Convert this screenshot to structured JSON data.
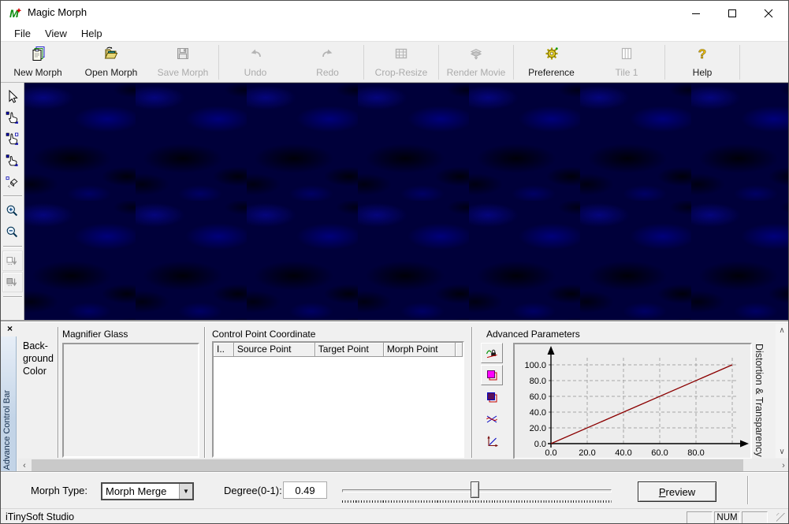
{
  "window": {
    "title": "Magic Morph"
  },
  "menu": {
    "items": [
      "File",
      "View",
      "Help"
    ]
  },
  "toolbar": {
    "buttons": [
      {
        "label": "New Morph",
        "icon": "new-morph-icon",
        "enabled": true
      },
      {
        "label": "Open Morph",
        "icon": "open-morph-icon",
        "enabled": true
      },
      {
        "label": "Save Morph",
        "icon": "save-morph-icon",
        "enabled": false
      },
      {
        "label": "Undo",
        "icon": "undo-icon",
        "enabled": false
      },
      {
        "label": "Redo",
        "icon": "redo-icon",
        "enabled": false
      },
      {
        "label": "Crop-Resize",
        "icon": "crop-resize-icon",
        "enabled": false
      },
      {
        "label": "Render Movie",
        "icon": "render-movie-icon",
        "enabled": false
      },
      {
        "label": "Preference",
        "icon": "preference-icon",
        "enabled": true
      },
      {
        "label": "Tile 1",
        "icon": "tile-icon",
        "enabled": false
      },
      {
        "label": "Help",
        "icon": "help-icon",
        "enabled": true
      }
    ]
  },
  "tool_palette": {
    "tools": [
      {
        "name": "select-tool",
        "enabled": true
      },
      {
        "name": "add-point-tool",
        "enabled": true
      },
      {
        "name": "add-point-pair-tool",
        "enabled": true
      },
      {
        "name": "move-point-tool",
        "enabled": true
      },
      {
        "name": "delete-point-tool",
        "enabled": true
      },
      {
        "name": "zoom-in-tool",
        "enabled": true
      },
      {
        "name": "zoom-out-tool",
        "enabled": true
      },
      {
        "name": "apply-image-1-tool",
        "enabled": false
      },
      {
        "name": "apply-image-2-tool",
        "enabled": false
      }
    ]
  },
  "panel": {
    "sidebar_label": "Advance Control Bar",
    "background_color_lines": [
      "Back-",
      "ground",
      "Color"
    ],
    "magnifier_title": "Magnifier Glass",
    "control_points": {
      "title": "Control Point Coordinate",
      "columns": [
        "I..",
        "Source Point",
        "Target Point",
        "Morph Point"
      ],
      "rows": []
    },
    "advanced": {
      "title": "Advanced Parameters",
      "side_label": "Distortion & Transparency",
      "chart_data": {
        "type": "line",
        "xlim": [
          0,
          100
        ],
        "ylim": [
          0,
          100
        ],
        "xticks": [
          0,
          20,
          40,
          60,
          80
        ],
        "xtick_labels": [
          "0.0",
          "20.0",
          "40.0",
          "60.0",
          "80.0"
        ],
        "yticks": [
          0,
          20,
          40,
          60,
          80,
          100
        ],
        "ytick_labels": [
          "0.0",
          "20.0",
          "40.0",
          "60.0",
          "80.0",
          "100.0"
        ],
        "xgrid": [
          20,
          40,
          60,
          80,
          100
        ],
        "ygrid": [
          20,
          40,
          60,
          80,
          100
        ],
        "grid": true,
        "legend": "none",
        "line_color": "#8b0000",
        "series": [
          {
            "name": "parameter-curve",
            "points": [
              [
                0,
                0
              ],
              [
                50,
                50
              ],
              [
                100,
                100
              ]
            ]
          }
        ]
      }
    }
  },
  "controls": {
    "morph_type_label": "Morph Type:",
    "morph_type_value": "Morph Merge",
    "degree_label": "Degree(0-1):",
    "degree_value": "0.49",
    "slider_percent": 49,
    "preview_accel": "P",
    "preview_rest": "review"
  },
  "status": {
    "left": "iTinySoft Studio",
    "num": "NUM"
  },
  "colors": {
    "canvas_blue": "#00003a",
    "curve_red": "#8b0000",
    "accent_magenta": "#ff00ff"
  }
}
